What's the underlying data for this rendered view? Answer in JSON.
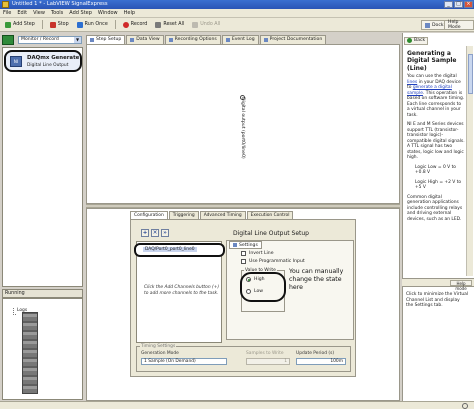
{
  "window": {
    "title": "Untitled 1 * - LabVIEW SignalExpress"
  },
  "menu": [
    "File",
    "Edit",
    "View",
    "Tools",
    "Add Step",
    "Window",
    "Help"
  ],
  "toolbar": {
    "add_step": "Add Step",
    "stop": "Stop",
    "run_once": "Run Once",
    "record": "Record",
    "reset_all": "Reset All",
    "undo": "Undo All",
    "dock": "Dock",
    "help_mode": "Help Mode"
  },
  "left_pane": {
    "mode": "Monitor / Record",
    "step": {
      "title": "DAQmx Generate",
      "subtitle": "Digital Line Output",
      "icon_text": "NI"
    },
    "running_header": "Running",
    "running_item": "Logs"
  },
  "main_tabs": [
    "Step Setup",
    "Data View",
    "Recording Options",
    "Event Log",
    "Project Documentation"
  ],
  "canvas": {
    "port_label": "Digital output (port0/line0)"
  },
  "config": {
    "tabs": [
      "Configuration",
      "Triggering",
      "Advanced Timing",
      "Execution Control"
    ],
    "channel_buttons": [
      "+",
      "✕",
      "»"
    ],
    "channel_name": "DAQ/Port0_port0_line0",
    "channel_help": "Click the Add Channels button (+) to add more channels to the task.",
    "setup_title": "Digital Line Output Setup",
    "settings_tab": "Settings",
    "invert_line": "Invert Line",
    "use_programmatic_input": "Use Programmatic Input",
    "value_to_write_label": "Value to Write",
    "value_options": [
      "High",
      "Low"
    ],
    "value_selected": "High",
    "callout": "You can manually change the state here",
    "timing": {
      "caption": "Timing Settings",
      "generation_mode_label": "Generation Mode",
      "generation_mode": "1 Sample (On Demand)",
      "samples_label": "Samples to Write",
      "samples_value": "1",
      "update_label": "Update Period (s)",
      "update_value": "100m"
    }
  },
  "help": {
    "back": "Back",
    "title": "Generating a Digital Sample (Line)",
    "p1_pre": "You can use the digital ",
    "p1_link1": "lines",
    "p1_mid": " in your DAQ device to ",
    "p1_link2": "generate a digital sample",
    "p1_post": ". This operation is based on software timing. Each line corresponds to a virtual channel in your task.",
    "p2": "NI E and M Series devices support TTL (transistor-transistor logic)-compatible digital signals. A TTL signal has two states, logic low and logic high.",
    "logic_low": "Logic Low = 0 V to +0.8 V",
    "logic_high": "Logic High = +2 V to +5 V",
    "p3": "Common digital generation applications include controlling relays and driving external devices, such as an LED.",
    "lower_header_btn": "Help mode",
    "lower_text": "Click to minimize the Virtual Channel List and display the Settings tab."
  }
}
